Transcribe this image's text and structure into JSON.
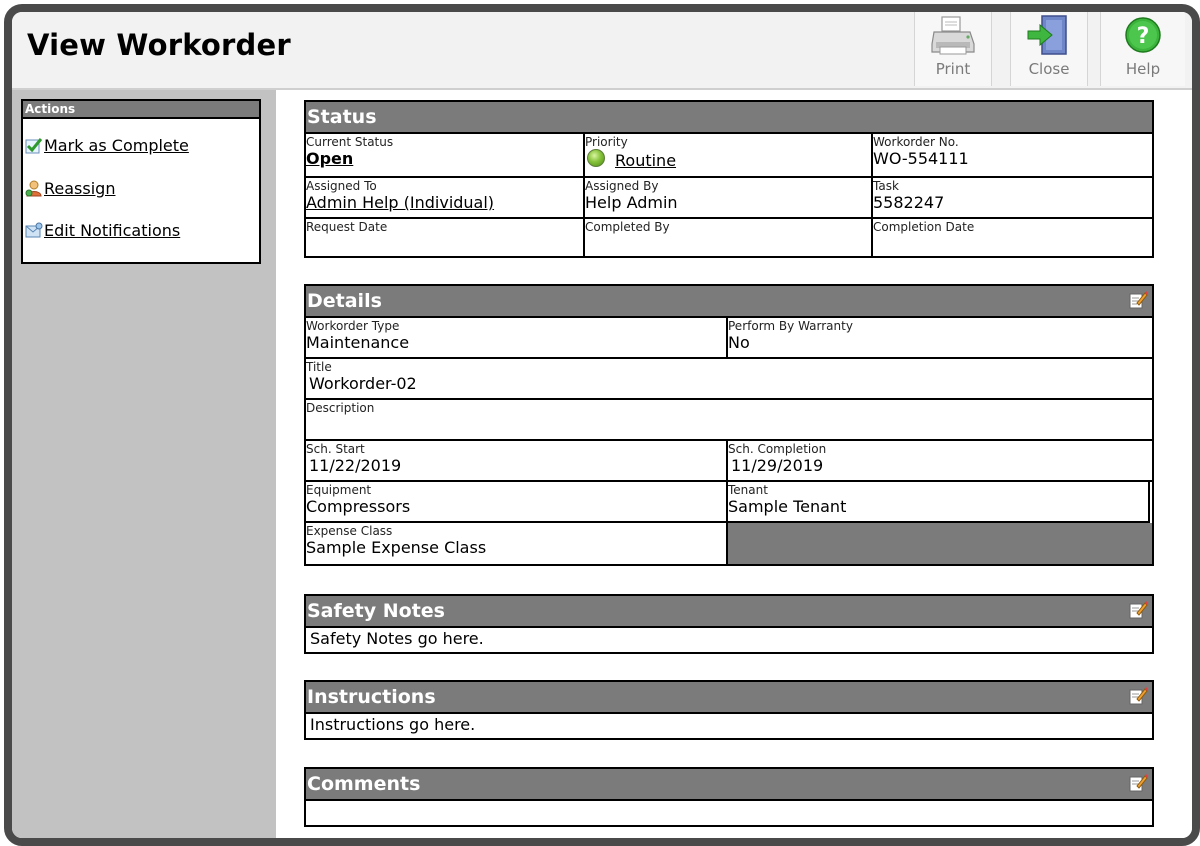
{
  "header": {
    "title": "View Workorder",
    "toolbar": {
      "print_label": "Print",
      "close_label": "Close",
      "help_label": "Help"
    }
  },
  "sidebar": {
    "actions_title": "Actions",
    "items": [
      {
        "label": "Mark as Complete",
        "icon": "check-icon"
      },
      {
        "label": "Reassign",
        "icon": "user-reassign-icon"
      },
      {
        "label": "Edit Notifications",
        "icon": "notification-icon"
      }
    ]
  },
  "status": {
    "title": "Status",
    "current_status_label": "Current Status",
    "current_status": "Open",
    "priority_label": "Priority",
    "priority": "Routine",
    "workorder_no_label": "Workorder No.",
    "workorder_no": "WO-554111",
    "assigned_to_label": "Assigned To",
    "assigned_to": "Admin Help (Individual)",
    "assigned_by_label": "Assigned By",
    "assigned_by": "Help Admin",
    "task_label": "Task",
    "task": "5582247",
    "request_date_label": "Request Date",
    "request_date": "",
    "completed_by_label": "Completed By",
    "completed_by": "",
    "completion_date_label": "Completion Date",
    "completion_date": ""
  },
  "details": {
    "title": "Details",
    "workorder_type_label": "Workorder Type",
    "workorder_type": "Maintenance",
    "warranty_label": "Perform By Warranty",
    "warranty": "No",
    "title_label": "Title",
    "title_value": "Workorder-02",
    "description_label": "Description",
    "description": "",
    "sch_start_label": "Sch. Start",
    "sch_start": "11/22/2019",
    "sch_completion_label": "Sch. Completion",
    "sch_completion": "11/29/2019",
    "equipment_label": "Equipment",
    "equipment": "Compressors",
    "tenant_label": "Tenant",
    "tenant": "Sample Tenant",
    "expense_class_label": "Expense Class",
    "expense_class": "Sample Expense Class"
  },
  "safety_notes": {
    "title": "Safety Notes",
    "text": "Safety Notes go here."
  },
  "instructions": {
    "title": "Instructions",
    "text": "Instructions go here."
  },
  "comments": {
    "title": "Comments",
    "text": ""
  },
  "colors": {
    "panel_header": "#7b7b7b",
    "sidebar_bg": "#c2c2c2",
    "frame": "#4a4a4a",
    "priority_dot": "#86c23a"
  }
}
